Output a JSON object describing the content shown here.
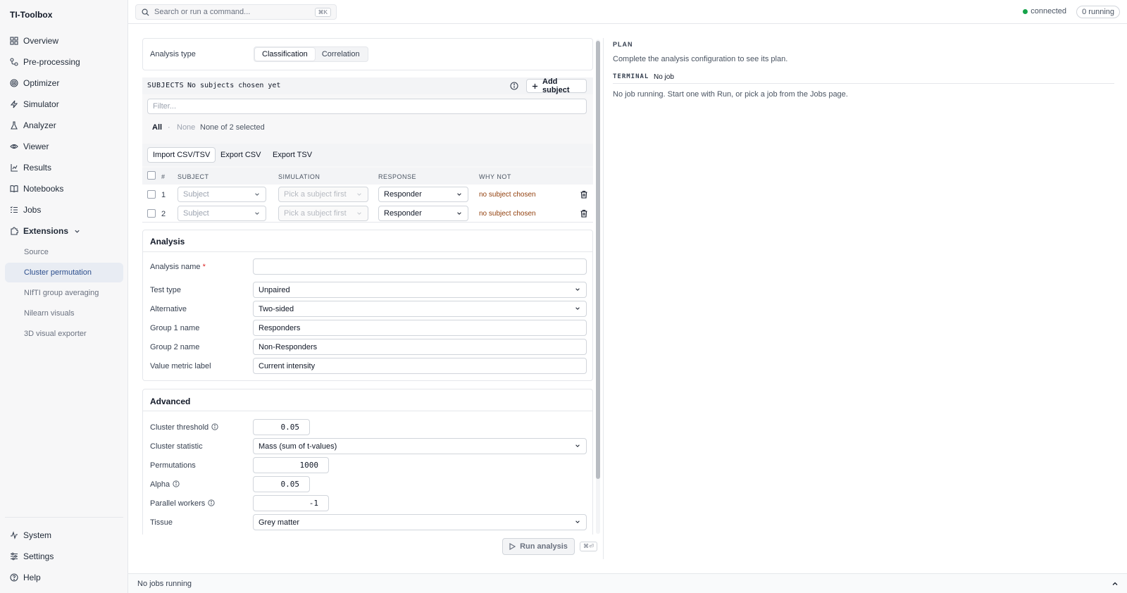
{
  "app": {
    "title": "TI-Toolbox"
  },
  "sidebar": {
    "items": [
      {
        "label": "Overview",
        "icon": "grid-icon"
      },
      {
        "label": "Pre-processing",
        "icon": "pipeline-icon"
      },
      {
        "label": "Optimizer",
        "icon": "target-icon"
      },
      {
        "label": "Simulator",
        "icon": "bolt-icon"
      },
      {
        "label": "Analyzer",
        "icon": "flask-icon"
      },
      {
        "label": "Viewer",
        "icon": "eye-icon"
      },
      {
        "label": "Results",
        "icon": "results-icon"
      },
      {
        "label": "Notebooks",
        "icon": "book-icon"
      },
      {
        "label": "Jobs",
        "icon": "list-icon"
      },
      {
        "label": "Extensions",
        "icon": "puzzle-icon"
      }
    ],
    "extensions": [
      "Source",
      "Cluster permutation",
      "NIfTI group averaging",
      "Nilearn visuals",
      "3D visual exporter"
    ],
    "bottom": [
      {
        "label": "System",
        "icon": "activity-icon"
      },
      {
        "label": "Settings",
        "icon": "sliders-icon"
      },
      {
        "label": "Help",
        "icon": "help-icon"
      }
    ]
  },
  "topbar": {
    "search_placeholder": "Search or run a command...",
    "shortcut": "⌘K",
    "status": "connected",
    "running": "0 running"
  },
  "analysis_type": {
    "label": "Analysis type",
    "options": [
      "Classification",
      "Correlation"
    ],
    "selected": "Classification"
  },
  "subjects": {
    "heading": "SUBJECTS",
    "status": "No subjects chosen yet",
    "add_label": "Add subject",
    "filter_placeholder": "Filter...",
    "all": "All",
    "sep": "·",
    "none": "None",
    "selected_text": "None of 2 selected",
    "import": "Import CSV/TSV",
    "export_csv": "Export CSV",
    "export_tsv": "Export TSV",
    "columns": [
      "#",
      "SUBJECT",
      "SIMULATION",
      "RESPONSE",
      "WHY NOT"
    ],
    "rows": [
      {
        "num": "1",
        "subject": "Subject",
        "simulation": "Pick a subject first",
        "response": "Responder",
        "why": "no subject chosen"
      },
      {
        "num": "2",
        "subject": "Subject",
        "simulation": "Pick a subject first",
        "response": "Responder",
        "why": "no subject chosen"
      }
    ]
  },
  "analysis": {
    "title": "Analysis",
    "name_label": "Analysis name",
    "required_mark": "*",
    "name_value": "",
    "test_type_label": "Test type",
    "test_type": "Unpaired",
    "alternative_label": "Alternative",
    "alternative": "Two-sided",
    "group1_label": "Group 1 name",
    "group1": "Responders",
    "group2_label": "Group 2 name",
    "group2": "Non-Responders",
    "metric_label": "Value metric label",
    "metric": "Current intensity"
  },
  "advanced": {
    "title": "Advanced",
    "threshold_label": "Cluster threshold",
    "threshold": "0.05",
    "statistic_label": "Cluster statistic",
    "statistic": "Mass (sum of t-values)",
    "permutations_label": "Permutations",
    "permutations": "1000",
    "alpha_label": "Alpha",
    "alpha": "0.05",
    "workers_label": "Parallel workers",
    "workers": "-1",
    "tissue_label": "Tissue",
    "tissue": "Grey matter"
  },
  "run": {
    "label": "Run analysis",
    "shortcut": "⌘⏎"
  },
  "plan": {
    "heading": "PLAN",
    "text": "Complete the analysis configuration to see its plan.",
    "terminal_heading": "TERMINAL",
    "terminal_status": "No job",
    "terminal_text": "No job running. Start one with Run, or pick a job from the Jobs page."
  },
  "footer": {
    "text": "No jobs running"
  }
}
